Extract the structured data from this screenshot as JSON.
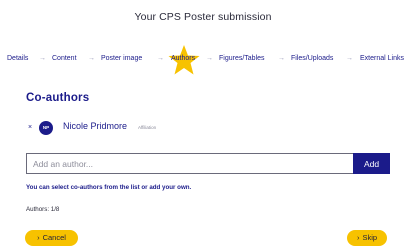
{
  "page_title": "Your CPS Poster submission",
  "steps": [
    {
      "label": "Details"
    },
    {
      "label": "Content"
    },
    {
      "label": "Poster image"
    },
    {
      "label": "Authors"
    },
    {
      "label": "Figures/Tables"
    },
    {
      "label": "Files/Uploads"
    },
    {
      "label": "External Links"
    }
  ],
  "step_separator": "→",
  "active_step": "Authors",
  "section_title": "Co-authors",
  "authors": [
    {
      "initials": "NP",
      "name": "Nicole Pridmore",
      "affiliation": "Affiliation",
      "remove": "×"
    }
  ],
  "add_author": {
    "placeholder": "Add an author...",
    "button_label": "Add"
  },
  "hint": "You can select co-authors from the list or add your own.",
  "author_count": "Authors: 1/8",
  "buttons": {
    "cancel_icon": "›",
    "cancel_label": "Cancel",
    "skip_icon": "›",
    "skip_label": "Skip"
  },
  "colors": {
    "brand": "#1b1b8a",
    "accent": "#f7c200",
    "star": "#f7c200"
  },
  "icons": {
    "star": "star-icon",
    "remove": "close-icon",
    "chevron": "chevron-right-icon"
  }
}
